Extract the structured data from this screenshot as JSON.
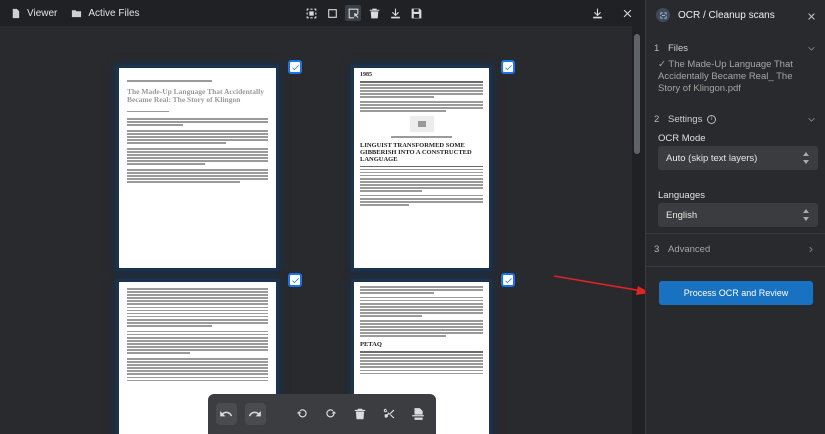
{
  "topbar": {
    "viewer_label": "Viewer",
    "active_files_label": "Active Files"
  },
  "panel": {
    "title": "OCR / Cleanup scans",
    "sections": {
      "files": {
        "num": "1",
        "label": "Files"
      },
      "settings": {
        "num": "2",
        "label": "Settings"
      },
      "advanced": {
        "num": "3",
        "label": "Advanced"
      }
    },
    "file_name": "✓ The Made-Up Language That Accidentally Became Real_ The Story of Klingon.pdf",
    "ocr_mode_label": "OCR Mode",
    "ocr_mode_value": "Auto (skip text layers)",
    "languages_label": "Languages",
    "languages_value": "English",
    "process_button": "Process OCR and Review"
  },
  "pages": {
    "p1_title": "The Made-Up Language That Accidentally Became Real: The Story of Klingon",
    "p2_year": "1985",
    "p2_heading": "LINGUIST TRANSFORMED SOME GIBBERISH INTO A CONSTRUCTED LANGUAGE",
    "p4_heading": "PETAQ"
  },
  "colors": {
    "accent": "#1971c2",
    "check": "#1a73e8",
    "annotation_arrow": "#e02424"
  }
}
